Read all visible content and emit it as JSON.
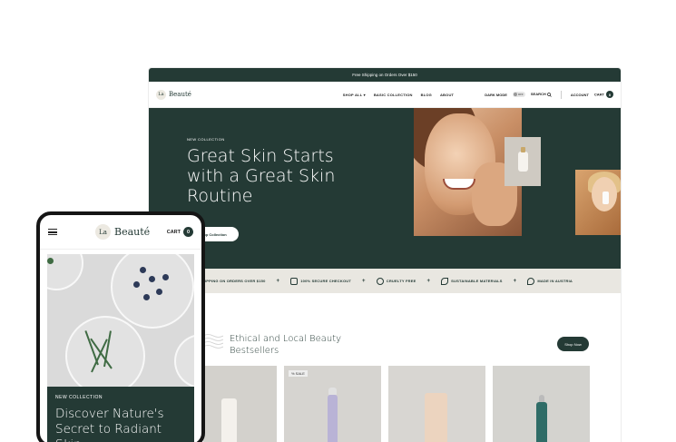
{
  "desktop": {
    "announcement": "Free Shipping on Orders Over $150",
    "logo": {
      "badge": "La",
      "name": "Beauté"
    },
    "menu": [
      "SHOP ALL",
      "BASIC COLLECTION",
      "BLOG",
      "ABOUT"
    ],
    "shop_all_caret": "▾",
    "utility": {
      "dark_mode": "DARK MODE",
      "toggle": "OFF",
      "search": "SEARCH",
      "account": "ACCOUNT",
      "cart": "CART",
      "cart_count": "0"
    },
    "hero": {
      "kicker": "NEW COLLECTION",
      "title": "Great Skin Starts with a Great Skin Routine",
      "button": "Shop Collection"
    },
    "features": [
      "SHIPPING ON ORDERS OVER $150",
      "100% SECURE CHECKOUT",
      "CRUELTY FREE",
      "SUSTAINABLE MATERIALS",
      "MADE IN AUSTRIA"
    ],
    "section": {
      "title_line1": "Ethical and Local Beauty",
      "title_line2": "Bestsellers",
      "button": "Shop Now",
      "sale_badge": "% SALE"
    }
  },
  "mobile": {
    "logo": {
      "badge": "La",
      "name": "Beauté"
    },
    "cart": "CART",
    "cart_count": "0",
    "hero": {
      "kicker": "NEW COLLECTION",
      "title": "Discover Nature's Secret to Radiant Skin"
    }
  },
  "colors": {
    "brand": "#243a35",
    "band": "#e9e7e1"
  }
}
